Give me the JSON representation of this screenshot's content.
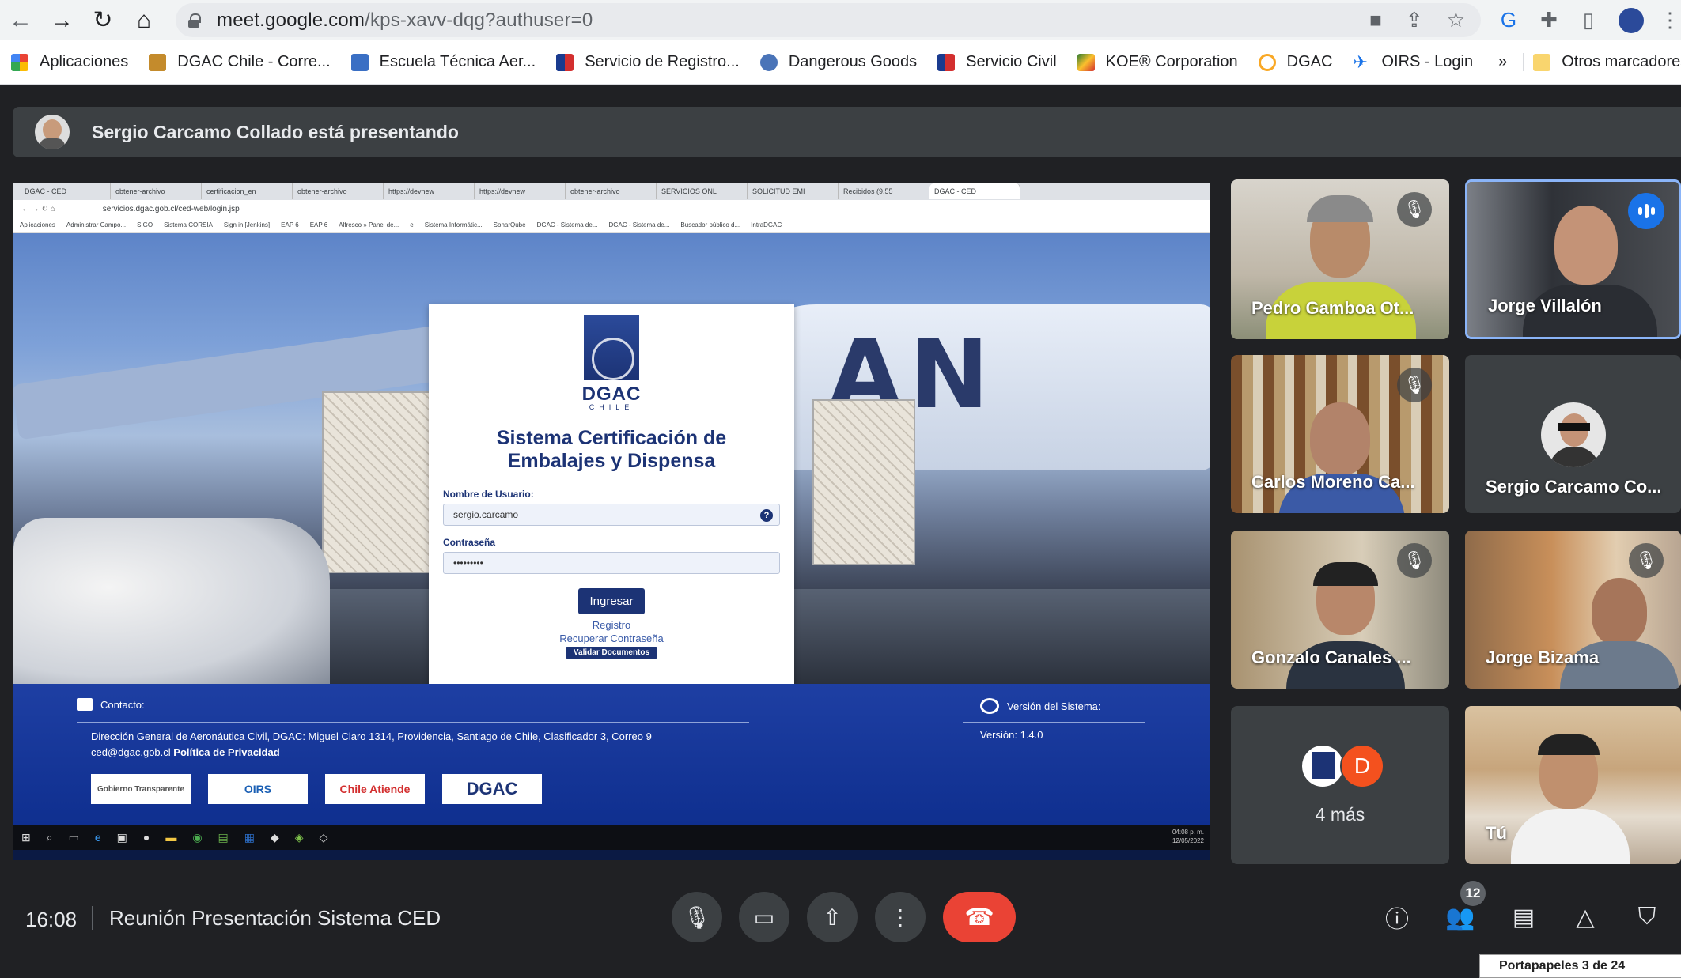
{
  "browser": {
    "url_host": "meet.google.com",
    "url_path": "/kps-xavv-dqg?authuser=0",
    "nav": {
      "back": "back-icon",
      "forward": "forward-icon",
      "reload": "reload-icon",
      "home": "home-icon"
    },
    "bookmarks": [
      {
        "label": "Aplicaciones",
        "color": "#ea4335"
      },
      {
        "label": "DGAC Chile - Corre...",
        "color": "#c48b2c"
      },
      {
        "label": "Escuela Técnica Aer...",
        "color": "#3a6fc4"
      },
      {
        "label": "Servicio de Registro...",
        "color": "#d32f2f"
      },
      {
        "label": "Dangerous Goods",
        "color": "#4a74b8"
      },
      {
        "label": "Servicio Civil",
        "color": "#d32f2f"
      },
      {
        "label": "KOE® Corporation",
        "color": "#2e7d32"
      },
      {
        "label": "DGAC",
        "color": "#f9a825"
      },
      {
        "label": "OIRS - Login",
        "color": "#1a73e8"
      }
    ],
    "more_bookmarks": "»",
    "other_bookmarks": "Otros marcadores"
  },
  "meet": {
    "presenter_banner": "Sergio Carcamo Collado está presentando",
    "shared_screen": {
      "tabs": [
        "DGAC - CED",
        "obtener-archivo",
        "certificacion_en",
        "obtener-archivo",
        "https://devnew",
        "https://devnew",
        "obtener-archivo",
        "SERVICIOS ONL",
        "SOLICITUD EMI",
        "Recibidos (9.55",
        "DGAC - CED"
      ],
      "address": "servicios.dgac.gob.cl/ced-web/login.jsp",
      "bookmarks": [
        "Aplicaciones",
        "Administrar Campo...",
        "SIGO",
        "Sistema CORSIA",
        "Sign in [Jenkins]",
        "EAP 6",
        "EAP 6",
        "Alfresco » Panel de...",
        "e",
        "Sistema Informátic...",
        "SonarQube",
        "DGAC - Sistema de...",
        "DGAC - Sistema de...",
        "Buscador público d...",
        "IntraDGAC"
      ],
      "login": {
        "logo_text": "DGAC",
        "logo_sub": "CHILE",
        "title_line1": "Sistema Certificación de",
        "title_line2": "Embalajes y Dispensa",
        "user_label": "Nombre de Usuario:",
        "user_value": "sergio.carcamo",
        "help": "?",
        "pass_label": "Contraseña",
        "pass_value": "•••••••••",
        "submit": "Ingresar",
        "register": "Registro",
        "recover": "Recuperar Contraseña",
        "validate": "Validar Documentos"
      },
      "hero_text": "AN",
      "footer": {
        "contact_label": "Contacto:",
        "address": "Dirección General de Aeronáutica Civil, DGAC: Miguel Claro 1314, Providencia, Santiago de Chile, Clasificador 3, Correo 9",
        "email": "ced@dgac.gob.cl",
        "privacy": "Política de Privacidad",
        "version_label": "Versión del Sistema:",
        "version": "Versión: 1.4.0",
        "logos": [
          "Gobierno Transparente",
          "OIRS",
          "Chile Atiende",
          "DGAC"
        ]
      },
      "taskbar_time": "04:08 p. m.",
      "taskbar_date": "12/05/2022"
    },
    "participants": [
      {
        "name": "Pedro Gamboa Ot...",
        "muted": true
      },
      {
        "name": "Jorge Villalón",
        "speaking": true
      },
      {
        "name": "Carlos Moreno Ca...",
        "muted": true
      },
      {
        "name": "Sergio Carcamo Co...",
        "muted": false
      },
      {
        "name": "Gonzalo Canales ...",
        "muted": true
      },
      {
        "name": "Jorge Bizama",
        "muted": true
      },
      {
        "name": "4 más",
        "avatar_letter": "D"
      },
      {
        "name": "Tú"
      }
    ],
    "bottom": {
      "time": "16:08",
      "title": "Reunión Presentación Sistema CED",
      "participants_count": "12",
      "clipboard": "Portapapeles 3 de 24"
    }
  }
}
